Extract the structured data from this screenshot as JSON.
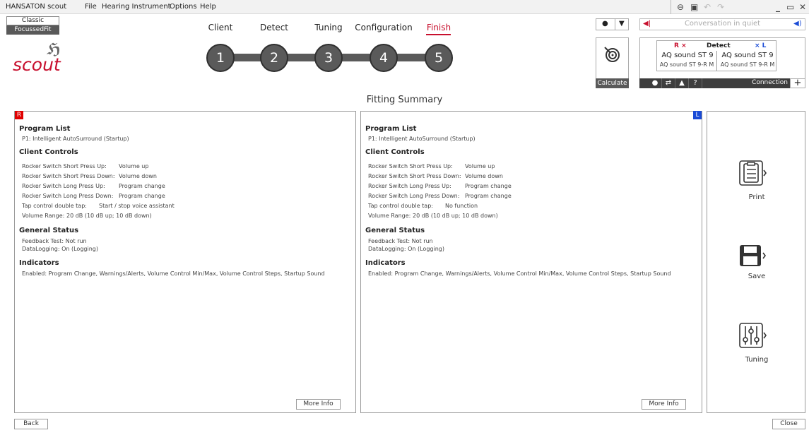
{
  "menubar": {
    "app_name": "HANSATON scout",
    "items": [
      "File",
      "Hearing Instrument",
      "Options",
      "Help"
    ]
  },
  "mode": {
    "classic": "Classic",
    "focussed": "FocussedFit"
  },
  "logo": {
    "text": "scout"
  },
  "workflow": {
    "steps": [
      {
        "label": "Client",
        "number": "1"
      },
      {
        "label": "Detect",
        "number": "2"
      },
      {
        "label": "Tuning",
        "number": "3"
      },
      {
        "label": "Configuration",
        "number": "4"
      },
      {
        "label": "Finish",
        "number": "5"
      }
    ],
    "active": "Finish"
  },
  "calculate": {
    "label": "Calculate"
  },
  "program": {
    "current": "Conversation in quiet"
  },
  "instrument": {
    "right_marker": "R ×",
    "detect": "Detect",
    "left_marker": "× L",
    "right_name": "AQ sound ST 9",
    "right_model": "AQ sound ST 9-R M",
    "left_name": "AQ sound ST 9",
    "left_model": "AQ sound ST 9-R M",
    "connection": "Connection"
  },
  "page_title": "Fitting Summary",
  "sides": {
    "right": "R",
    "left": "L"
  },
  "summary": {
    "right": {
      "program_list_title": "Program List",
      "program_list": [
        "P1: Intelligent AutoSurround (Startup)"
      ],
      "client_controls_title": "Client Controls",
      "client_controls": [
        {
          "label": "Rocker Switch Short Press Up:",
          "value": "Volume up"
        },
        {
          "label": "Rocker Switch Short Press Down:",
          "value": "Volume down"
        },
        {
          "label": "Rocker Switch Long Press Up:",
          "value": "Program change"
        },
        {
          "label": "Rocker Switch Long Press Down:",
          "value": "Program change"
        },
        {
          "label": "Tap control double tap:",
          "value": "Start / stop voice assistant"
        },
        {
          "label": "Volume Range:",
          "value": "20 dB (10 dB up; 10 dB down)"
        }
      ],
      "general_status_title": "General Status",
      "general_status": [
        "Feedback Test: Not run",
        "DataLogging: On (Logging)"
      ],
      "indicators_title": "Indicators",
      "indicators": "Enabled: Program Change, Warnings/Alerts, Volume Control Min/Max, Volume Control Steps, Startup Sound",
      "more_info": "More Info"
    },
    "left": {
      "program_list_title": "Program List",
      "program_list": [
        "P1: Intelligent AutoSurround (Startup)"
      ],
      "client_controls_title": "Client Controls",
      "client_controls": [
        {
          "label": "Rocker Switch Short Press Up:",
          "value": "Volume up"
        },
        {
          "label": "Rocker Switch Short Press Down:",
          "value": "Volume down"
        },
        {
          "label": "Rocker Switch Long Press Up:",
          "value": "Program change"
        },
        {
          "label": "Rocker Switch Long Press Down:",
          "value": "Program change"
        },
        {
          "label": "Tap control double tap:",
          "value": "No function"
        },
        {
          "label": "Volume Range:",
          "value": "20 dB (10 dB up; 10 dB down)"
        }
      ],
      "general_status_title": "General Status",
      "general_status": [
        "Feedback Test: Not run",
        "DataLogging: On (Logging)"
      ],
      "indicators_title": "Indicators",
      "indicators": "Enabled: Program Change, Warnings/Alerts, Volume Control Min/Max, Volume Control Steps, Startup Sound",
      "more_info": "More Info"
    }
  },
  "actions": {
    "print": "Print",
    "save": "Save",
    "tuning": "Tuning"
  },
  "footer": {
    "back": "Back",
    "close": "Close"
  },
  "colors": {
    "accent_red": "#c8102e",
    "left_blue": "#1a4bd6",
    "dark_gray": "#5a5a5a"
  },
  "icons": [
    "lock-icon",
    "save-icon",
    "undo-icon",
    "redo-icon",
    "minimize-icon",
    "restore-icon",
    "close-icon",
    "person-icon",
    "target-icon",
    "speaker-icon",
    "clipboard-icon",
    "floppy-icon",
    "sliders-icon"
  ]
}
